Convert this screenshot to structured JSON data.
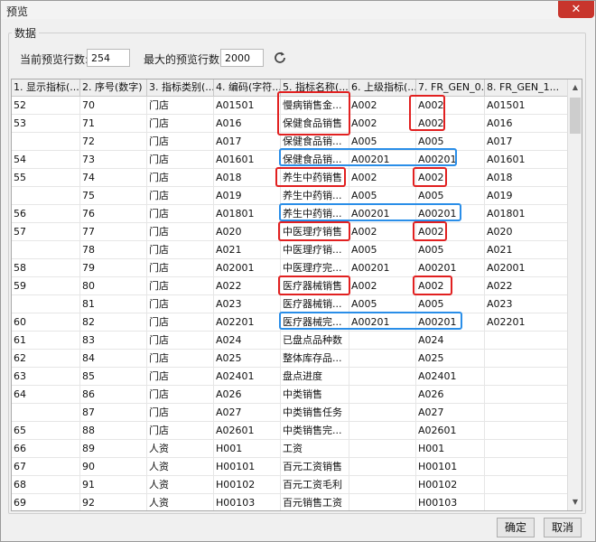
{
  "window": {
    "title": "预览",
    "close_glyph": "✕"
  },
  "group": {
    "legend": "数据"
  },
  "toolbar": {
    "current_rows_label": "当前预览行数:",
    "current_rows_value": "254",
    "max_rows_label": "最大的预览行数:",
    "max_rows_value": "2000",
    "refresh_icon": "refresh-icon"
  },
  "table": {
    "columns": [
      "1. 显示指标(...",
      "2. 序号(数字)",
      "3. 指标类别(...",
      "4. 编码(字符...",
      "5. 指标名称(...",
      "6. 上级指标(...",
      "7. FR_GEN_0...",
      "8. FR_GEN_1..."
    ],
    "rows": [
      [
        "52",
        "70",
        "门店",
        "A01501",
        "慢病销售金...",
        "A002",
        "A002",
        "A01501"
      ],
      [
        "53",
        "71",
        "门店",
        "A016",
        "保健食品销售",
        "A002",
        "A002",
        "A016"
      ],
      [
        "",
        "72",
        "门店",
        "A017",
        "保健食品销...",
        "A005",
        "A005",
        "A017"
      ],
      [
        "54",
        "73",
        "门店",
        "A01601",
        "保健食品销...",
        "A00201",
        "A00201",
        "A01601"
      ],
      [
        "55",
        "74",
        "门店",
        "A018",
        "养生中药销售",
        "A002",
        "A002",
        "A018"
      ],
      [
        "",
        "75",
        "门店",
        "A019",
        "养生中药销...",
        "A005",
        "A005",
        "A019"
      ],
      [
        "56",
        "76",
        "门店",
        "A01801",
        "养生中药销...",
        "A00201",
        "A00201",
        "A01801"
      ],
      [
        "57",
        "77",
        "门店",
        "A020",
        "中医理疗销售",
        "A002",
        "A002",
        "A020"
      ],
      [
        "",
        "78",
        "门店",
        "A021",
        "中医理疗销...",
        "A005",
        "A005",
        "A021"
      ],
      [
        "58",
        "79",
        "门店",
        "A02001",
        "中医理疗完...",
        "A00201",
        "A00201",
        "A02001"
      ],
      [
        "59",
        "80",
        "门店",
        "A022",
        "医疗器械销售",
        "A002",
        "A002",
        "A022"
      ],
      [
        "",
        "81",
        "门店",
        "A023",
        "医疗器械销...",
        "A005",
        "A005",
        "A023"
      ],
      [
        "60",
        "82",
        "门店",
        "A02201",
        "医疗器械完...",
        "A00201",
        "A00201",
        "A02201"
      ],
      [
        "61",
        "83",
        "门店",
        "A024",
        "已盘点品种数",
        "",
        "A024",
        ""
      ],
      [
        "62",
        "84",
        "门店",
        "A025",
        "整体库存品...",
        "",
        "A025",
        ""
      ],
      [
        "63",
        "85",
        "门店",
        "A02401",
        "盘点进度",
        "",
        "A02401",
        ""
      ],
      [
        "64",
        "86",
        "门店",
        "A026",
        "中类销售",
        "",
        "A026",
        ""
      ],
      [
        "",
        "87",
        "门店",
        "A027",
        "中类销售任务",
        "",
        "A027",
        ""
      ],
      [
        "65",
        "88",
        "门店",
        "A02601",
        "中类销售完...",
        "",
        "A02601",
        ""
      ],
      [
        "66",
        "89",
        "人资",
        "H001",
        "工资",
        "",
        "H001",
        ""
      ],
      [
        "67",
        "90",
        "人资",
        "H00101",
        "百元工资销售",
        "",
        "H00101",
        ""
      ],
      [
        "68",
        "91",
        "人资",
        "H00102",
        "百元工资毛利",
        "",
        "H00102",
        ""
      ],
      [
        "69",
        "92",
        "人资",
        "H00103",
        "百元销售工资",
        "",
        "H00103",
        ""
      ]
    ]
  },
  "buttons": {
    "ok": "确定",
    "cancel": "取消"
  },
  "colors": {
    "red_mark": "#e12020",
    "blue_mark": "#2a8ee8"
  }
}
